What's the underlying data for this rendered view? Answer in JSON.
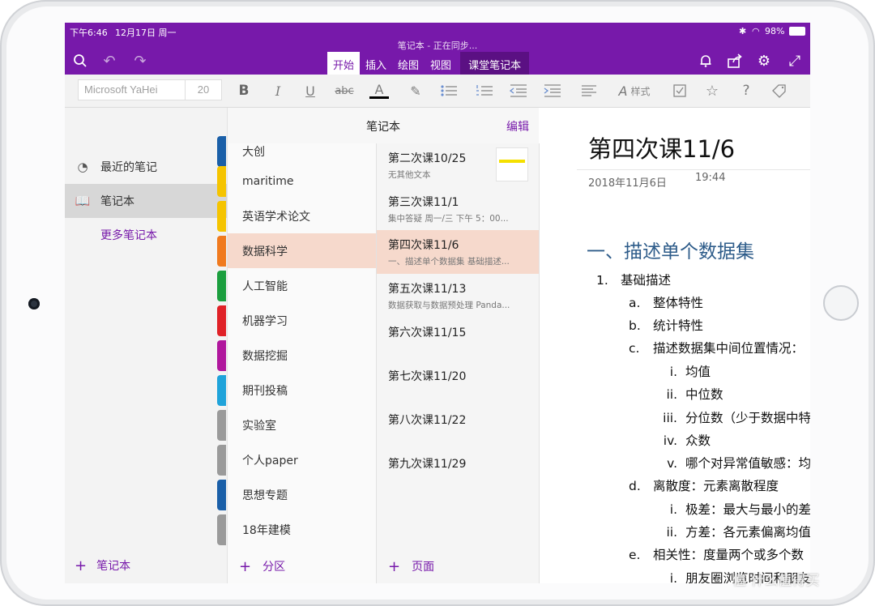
{
  "status": {
    "time": "下午6:46",
    "date": "12月17日 周一",
    "battery": "98%"
  },
  "window_title": "笔记本 - 正在同步...",
  "tabs": [
    {
      "label": "开始",
      "active": true
    },
    {
      "label": "插入"
    },
    {
      "label": "绘图"
    },
    {
      "label": "视图"
    },
    {
      "label": "课堂笔记本"
    }
  ],
  "ribbon": {
    "font_name": "Microsoft YaHei",
    "font_size": "20",
    "bold": "B",
    "italic": "I",
    "underline": "U",
    "strike": "abc",
    "font_color": "A",
    "styles_label": "样式"
  },
  "nav": {
    "recent": "最近的笔记",
    "notebook": "笔记本",
    "more": "更多笔记本",
    "add": "笔记本"
  },
  "column_header": {
    "title": "笔记本",
    "edit": "编辑"
  },
  "sections": [
    {
      "label": "大创",
      "color": "#1a5fa8"
    },
    {
      "label": "maritime",
      "color": "#f5c400"
    },
    {
      "label": "英语学术论文",
      "color": "#f5c400"
    },
    {
      "label": "数据科学",
      "color": "#f07a1e"
    },
    {
      "label": "人工智能",
      "color": "#1b9e3e"
    },
    {
      "label": "机器学习",
      "color": "#e02127"
    },
    {
      "label": "数据挖掘",
      "color": "#b0179d"
    },
    {
      "label": "期刊投稿",
      "color": "#1fa3da"
    },
    {
      "label": "实验室",
      "color": "#9a9a9a"
    },
    {
      "label": "个人paper",
      "color": "#9a9a9a"
    },
    {
      "label": "思想专题",
      "color": "#1a5fa8"
    },
    {
      "label": "18年建模",
      "color": "#9a9a9a"
    }
  ],
  "sections_add": "分区",
  "pages": [
    {
      "title": "第二次课10/25",
      "sub": "无其他文本"
    },
    {
      "title": "第三次课11/1",
      "sub": "集中答疑 周一/三 下午 5：00..."
    },
    {
      "title": "第四次课11/6",
      "sub": "一、描述单个数据集 基础描述..."
    },
    {
      "title": "第五次课11/13",
      "sub": "数据获取与数据预处理 Panda..."
    },
    {
      "title": "第六次课11/15",
      "sub": ""
    },
    {
      "title": "第七次课11/20",
      "sub": ""
    },
    {
      "title": "第八次课11/22",
      "sub": ""
    },
    {
      "title": "第九次课11/29",
      "sub": ""
    }
  ],
  "pages_add": "页面",
  "note": {
    "title": "第四次课11/6",
    "date": "2018年11月6日",
    "time": "19:44",
    "heading": "一、描述单个数据集",
    "lines": [
      {
        "marker": "1.",
        "text": "基础描述"
      },
      {
        "marker": "a.",
        "text": "整体特性"
      },
      {
        "marker": "b.",
        "text": "统计特性"
      },
      {
        "marker": "c.",
        "text": "描述数据集中间位置情况："
      },
      {
        "marker": "i.",
        "text": "均值"
      },
      {
        "marker": "ii.",
        "text": "中位数"
      },
      {
        "marker": "iii.",
        "text": "分位数（少于数据中特"
      },
      {
        "marker": "iv.",
        "text": "众数"
      },
      {
        "marker": "v.",
        "text": "哪个对异常值敏感：均"
      },
      {
        "marker": "d.",
        "text": "离散度：元素离散程度"
      },
      {
        "marker": "i.",
        "text": "极差：最大与最小的差"
      },
      {
        "marker": "ii.",
        "text": "方差：各元素偏离均值"
      },
      {
        "marker": "e.",
        "text": "相关性：度量两个或多个数"
      },
      {
        "marker": "i.",
        "text": "朋友圈浏览时间和朋友"
      }
    ]
  },
  "watermark": "值 什么值得买",
  "colors": {
    "brand": "#7719aa",
    "selected": "#f6d9cc"
  }
}
